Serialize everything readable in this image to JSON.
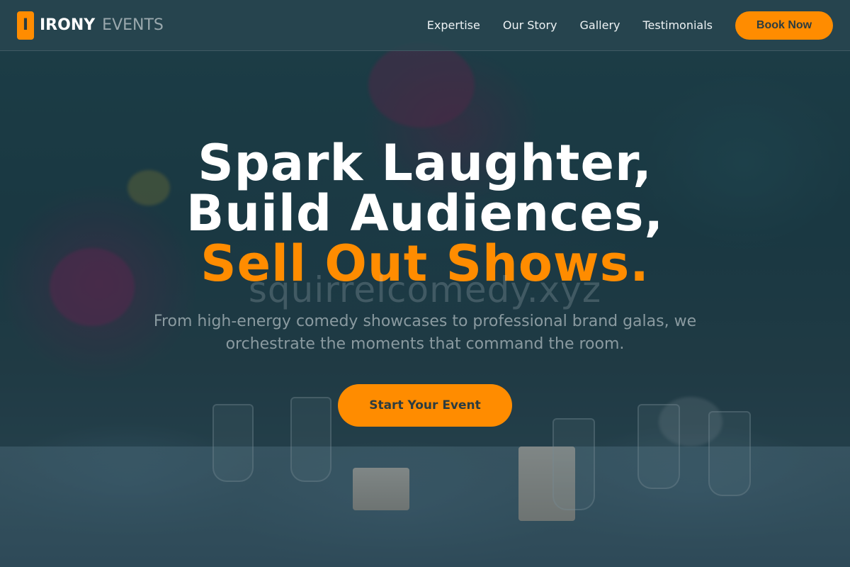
{
  "brand": {
    "mark": "I",
    "name": "IRONY",
    "suffix": "EVENTS"
  },
  "nav": {
    "items": [
      "Expertise",
      "Our Story",
      "Gallery",
      "Testimonials"
    ],
    "cta_label": "Book Now"
  },
  "hero": {
    "line1": "Spark Laughter,",
    "line2": "Build Audiences,",
    "line3": "Sell Out Shows.",
    "watermark": "squirrelcomedy.xyz",
    "subtitle": "From high-energy comedy showcases to professional brand galas, we orchestrate the moments that command the room.",
    "cta_label": "Start Your Event"
  },
  "colors": {
    "accent": "#ff8c00",
    "header_bg": "#2d4f58",
    "text_light": "#ffffff",
    "text_muted": "#8a9aa0"
  }
}
